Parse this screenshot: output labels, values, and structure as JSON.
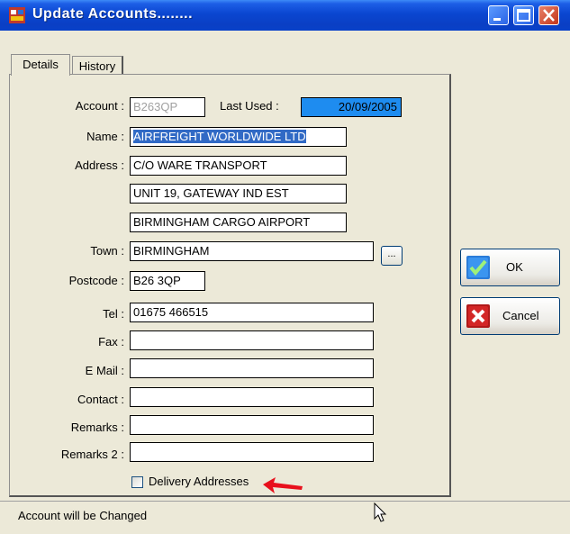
{
  "window": {
    "title": "Update Accounts........",
    "colors": {
      "titlebar": "#0a46d0",
      "accent": "#316ac5",
      "close": "#c2351a"
    }
  },
  "tabs": [
    {
      "label": "Details",
      "active": true
    },
    {
      "label": "History",
      "active": false
    }
  ],
  "form": {
    "account": {
      "label": "Account :",
      "value": "B263QP"
    },
    "last_used": {
      "label": "Last Used :",
      "value": "20/09/2005"
    },
    "name": {
      "label": "Name :",
      "value": "AIRFREIGHT WORLDWIDE LTD"
    },
    "address": {
      "label": "Address :",
      "lines": [
        "C/O WARE TRANSPORT",
        "UNIT 19, GATEWAY IND EST",
        "BIRMINGHAM CARGO AIRPORT"
      ]
    },
    "town": {
      "label": "Town :",
      "value": "BIRMINGHAM",
      "browse": "..."
    },
    "postcode": {
      "label": "Postcode :",
      "value": "B26 3QP"
    },
    "tel": {
      "label": "Tel :",
      "value": "01675 466515"
    },
    "fax": {
      "label": "Fax :",
      "value": ""
    },
    "email": {
      "label": "E Mail :",
      "value": ""
    },
    "contact": {
      "label": "Contact :",
      "value": ""
    },
    "remarks": {
      "label": "Remarks :",
      "value": ""
    },
    "remarks2": {
      "label": "Remarks 2 :",
      "value": ""
    },
    "delivery_addresses": {
      "label": "Delivery Addresses",
      "checked": false
    }
  },
  "buttons": {
    "ok": "OK",
    "cancel": "Cancel"
  },
  "status": "Account will be Changed",
  "icons": [
    "app-icon",
    "minimize-icon",
    "maximize-icon",
    "close-icon",
    "checkmark-icon",
    "x-icon",
    "annotation-arrow-icon",
    "mouse-cursor-icon"
  ]
}
